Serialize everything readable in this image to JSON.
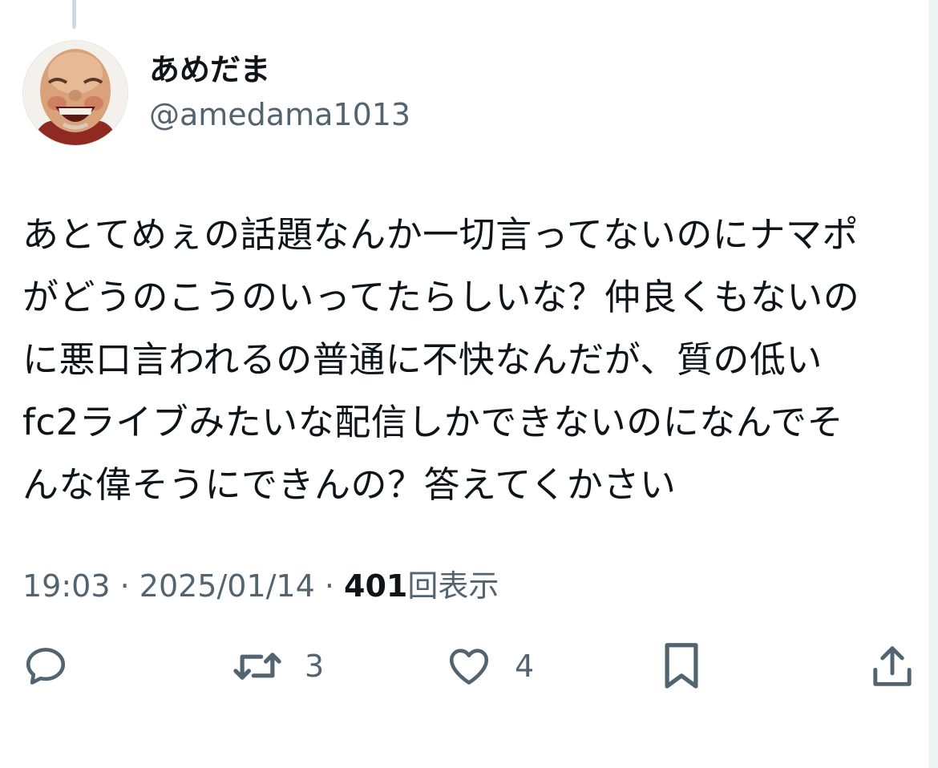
{
  "tweet": {
    "display_name": "あめだま",
    "handle": "@amedama1013",
    "text": "あとてめぇの話題なんか一切言ってないのにナマポ\nがどうのこうのいってたらしいな？仲良くもないの\nに悪口言われるの普通に不快なんだが、質の低い\nfc2ライブみたいな配信しかできないのになんでそ\nんな偉そうにできんの？答えてくかさい",
    "time": "19:03",
    "date": "2025/01/14",
    "separator": " · ",
    "view_count": "401",
    "view_label": "回表示"
  },
  "actions": {
    "reply": {
      "icon": "reply-icon",
      "count": ""
    },
    "retweet": {
      "icon": "retweet-icon",
      "count": "3"
    },
    "like": {
      "icon": "heart-icon",
      "count": "4"
    },
    "bookmark": {
      "icon": "bookmark-icon",
      "count": ""
    },
    "share": {
      "icon": "share-icon",
      "count": ""
    }
  },
  "colors": {
    "text_primary": "#0f1419",
    "text_secondary": "#536471",
    "thread_line": "#cfd9de",
    "background": "#ffffff"
  }
}
